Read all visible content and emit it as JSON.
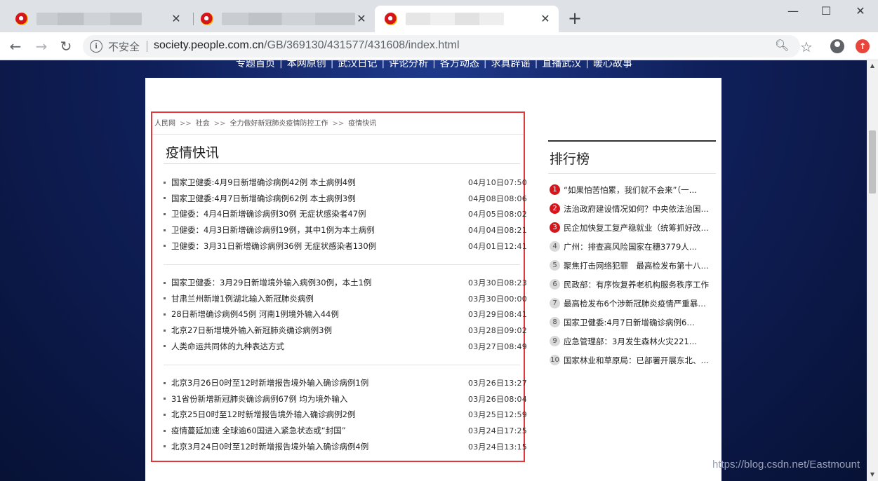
{
  "browser": {
    "tabs": [
      {
        "title": "",
        "active": false
      },
      {
        "title": "",
        "active": false
      },
      {
        "title": "",
        "active": true
      }
    ],
    "new_tab": "+",
    "window_controls": {
      "minimize": "—",
      "maximize": "☐",
      "close": "✕"
    },
    "security_label": "不安全",
    "url_host": "society.people.com.cn",
    "url_path": "/GB/369130/431577/431608/index.html"
  },
  "topnav": [
    "专题首页",
    "本网原创",
    "武汉日记",
    "评论分析",
    "各方动态",
    "求真辟谣",
    "直播武汉",
    "暖心故事"
  ],
  "breadcrumb": {
    "home": "人民网",
    "section": "社会",
    "topic": "全力做好新冠肺炎疫情防控工作",
    "current": "疫情快讯",
    "separator": ">>"
  },
  "panel_title": "疫情快讯",
  "news_groups": [
    [
      {
        "title": "国家卫健委:4月9日新增确诊病例42例 本土病例4例",
        "time": "04月10日07:50"
      },
      {
        "title": "国家卫健委:4月7日新增确诊病例62例 本土病例3例",
        "time": "04月08日08:06"
      },
      {
        "title": "卫健委：4月4日新增确诊病例30例 无症状感染者47例",
        "time": "04月05日08:02"
      },
      {
        "title": "卫健委：4月3日新增确诊病例19例，其中1例为本土病例",
        "time": "04月04日08:21"
      },
      {
        "title": "卫健委：3月31日新增确诊病例36例 无症状感染者130例",
        "time": "04月01日12:41"
      }
    ],
    [
      {
        "title": "国家卫健委：3月29日新增境外输入病例30例，本土1例",
        "time": "03月30日08:23"
      },
      {
        "title": "甘肃兰州新增1例湖北输入新冠肺炎病例",
        "time": "03月30日00:00"
      },
      {
        "title": "28日新增确诊病例45例 河南1例境外输入44例",
        "time": "03月29日08:41"
      },
      {
        "title": "北京27日新增境外输入新冠肺炎确诊病例3例",
        "time": "03月28日09:02"
      },
      {
        "title": "人类命运共同体的九种表达方式",
        "time": "03月27日08:49"
      }
    ],
    [
      {
        "title": "北京3月26日0时至12时新增报告境外输入确诊病例1例",
        "time": "03月26日13:27"
      },
      {
        "title": "31省份新增新冠肺炎确诊病例67例 均为境外输入",
        "time": "03月26日08:04"
      },
      {
        "title": "北京25日0时至12时新增报告境外输入确诊病例2例",
        "time": "03月25日12:59"
      },
      {
        "title": "疫情蔓延加速 全球逾60国进入紧急状态或“封国”",
        "time": "03月24日17:25"
      },
      {
        "title": "北京3月24日0时至12时新增报告境外输入确诊病例4例",
        "time": "03月24日13:15"
      }
    ]
  ],
  "ranking": {
    "title": "排行榜",
    "items": [
      {
        "num": "1",
        "text": "“如果怕苦怕累，我们就不会来”（一…"
      },
      {
        "num": "2",
        "text": "法治政府建设情况如何？中央依法治国…"
      },
      {
        "num": "3",
        "text": "民企加快复工复产稳就业（统筹抓好改…"
      },
      {
        "num": "4",
        "text": "广州：排查高风险国家在穗3779人…"
      },
      {
        "num": "5",
        "text": "聚焦打击网络犯罪　最高检发布第十八…"
      },
      {
        "num": "6",
        "text": "民政部：有序恢复养老机构服务秩序工作"
      },
      {
        "num": "7",
        "text": "最高检发布6个涉新冠肺炎疫情严重暴…"
      },
      {
        "num": "8",
        "text": "国家卫健委:4月7日新增确诊病例6…"
      },
      {
        "num": "9",
        "text": "应急管理部：3月发生森林火灾221…"
      },
      {
        "num": "10",
        "text": "国家林业和草原局：已部署开展东北、…"
      }
    ]
  },
  "watermark": "https://blog.csdn.net/Eastmount"
}
